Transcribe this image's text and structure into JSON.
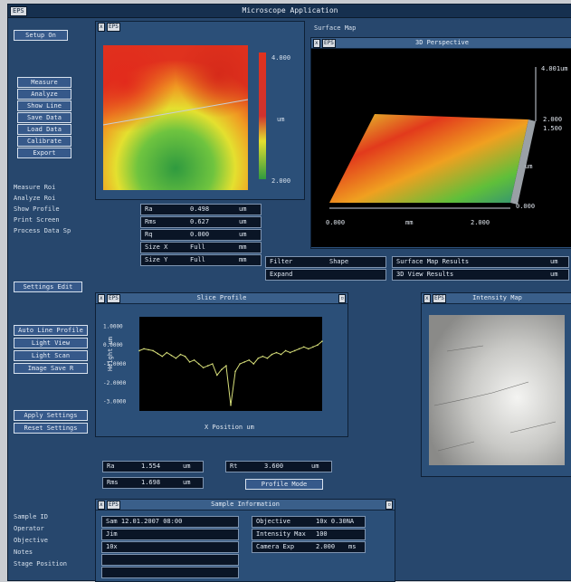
{
  "window": {
    "title": "Microscope Application",
    "corner_tag": "EPS"
  },
  "top_left_button": "Setup  On",
  "left_buttons": [
    "Measure",
    "Analyze",
    "Show Line",
    "Save Data",
    "Load Data",
    "Calibrate",
    "Export"
  ],
  "left_labels": [
    "Measure Roi",
    "Analyze Roi",
    "Show Profile",
    "Print Screen",
    "Process Data Sp"
  ],
  "left_lower_button": "Settings Edit",
  "left_mid_labels": [
    "Auto Line Profile",
    "Light View",
    "Light Scan",
    "Image Save R"
  ],
  "left_mid_labels2": [
    "Apply Settings",
    "Reset Settings"
  ],
  "left_bottom_labels": [
    "Sample ID",
    "Operator",
    "Objective",
    "Notes",
    "Stage Position"
  ],
  "surface_map": {
    "tag": "EPS",
    "scale_top": "4.000",
    "scale_mid": "um",
    "scale_bot": "2.000"
  },
  "surface_header": "Surface Map",
  "view3d": {
    "tag": "EPS",
    "title": "3D Perspective",
    "z_top": "4.001um",
    "z_mid1": "2.000",
    "z_mid2": "1.500",
    "z_unit": "um",
    "x_min": "0.000",
    "x_unit": "mm",
    "x_max": "2.000",
    "y_max": "0.000"
  },
  "stats": [
    {
      "name": "Ra",
      "value": "0.498",
      "unit": "um"
    },
    {
      "name": "Rms",
      "value": "0.627",
      "unit": "um"
    },
    {
      "name": "Rq",
      "value": "0.000",
      "unit": "um"
    },
    {
      "name": "Size X",
      "value": "Full",
      "unit": "mm"
    },
    {
      "name": "Size Y",
      "value": "Full",
      "unit": "mm"
    }
  ],
  "mid_fields": [
    {
      "name": "Filter",
      "value": "Shape"
    },
    {
      "name": "Expand",
      "value": ""
    }
  ],
  "right_fields": [
    {
      "name": "Surface Map Results",
      "unit": "um"
    },
    {
      "name": "3D View Results",
      "unit": "um"
    }
  ],
  "profile": {
    "tag": "EPS",
    "title": "Slice Profile",
    "y_ticks": [
      "1.0000",
      "0.0000",
      "-1.0000",
      "-2.0000",
      "-3.0000"
    ],
    "x_label": "X Position um",
    "ylabel": "Height um"
  },
  "profile_fields": [
    {
      "name": "Ra",
      "value": "1.554",
      "unit": "um"
    },
    {
      "name": "Rms",
      "value": "1.698",
      "unit": "um"
    },
    {
      "name": "Rt",
      "value": "3.600",
      "unit": "um"
    }
  ],
  "profile_button": "Profile Mode",
  "intensity": {
    "tag": "EPS",
    "title": "Intensity Map"
  },
  "bottom": {
    "tag": "EPS",
    "title": "Sample Information",
    "fields": [
      {
        "value": "Sam 12.01.2007 08:00"
      },
      {
        "value": "Jim"
      },
      {
        "value": "10x"
      },
      {
        "value": ""
      },
      {
        "value": ""
      }
    ],
    "right_fields": [
      {
        "name": "Objective",
        "value": "10x 0.30NA"
      },
      {
        "name": "Intensity Max",
        "value": "100"
      },
      {
        "name": "Camera Exp",
        "value": "2.000",
        "unit": "ms"
      }
    ]
  },
  "chart_data": {
    "type": "line",
    "x": [
      0,
      5,
      10,
      15,
      20,
      25,
      30,
      35,
      40,
      45,
      50,
      55,
      60,
      65,
      70,
      75,
      80,
      85,
      90,
      95,
      100,
      105,
      110,
      115,
      120,
      125,
      130,
      135,
      140,
      145,
      150,
      155,
      160,
      165,
      170,
      175,
      180,
      185,
      190,
      195,
      200
    ],
    "series": [
      {
        "values": [
          -0.3,
          -0.2,
          -0.25,
          -0.3,
          -0.45,
          -0.6,
          -0.4,
          -0.55,
          -0.7,
          -0.5,
          -0.6,
          -0.9,
          -0.8,
          -1.0,
          -1.2,
          -1.1,
          -1.0,
          -1.6,
          -1.3,
          -1.1,
          -3.2,
          -1.4,
          -1.0,
          -0.9,
          -0.8,
          -1.0,
          -0.7,
          -0.6,
          -0.7,
          -0.5,
          -0.4,
          -0.5,
          -0.3,
          -0.4,
          -0.3,
          -0.2,
          -0.1,
          -0.2,
          -0.1,
          0.0,
          0.2
        ]
      }
    ],
    "ylim": [
      -3.5,
      1.5
    ],
    "grid": false
  }
}
